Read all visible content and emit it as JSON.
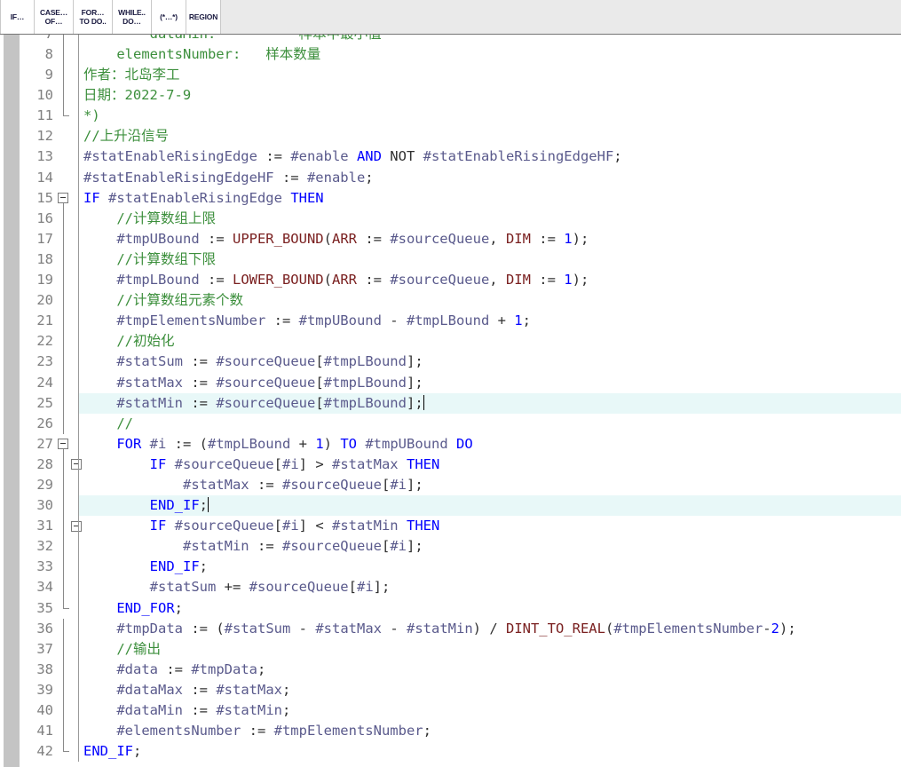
{
  "toolbar": {
    "buttons": [
      {
        "name": "if-button",
        "line1": "IF…",
        "line2": ""
      },
      {
        "name": "case-of-button",
        "line1": "CASE…",
        "line2": "OF…"
      },
      {
        "name": "for-todo-button",
        "line1": "FOR…",
        "line2": "TO DO.."
      },
      {
        "name": "while-do-button",
        "line1": "WHILE..",
        "line2": "DO…"
      },
      {
        "name": "comment-button",
        "line1": "(*…*)",
        "line2": ""
      },
      {
        "name": "region-button",
        "line1": "REGION",
        "line2": ""
      }
    ]
  },
  "editor": {
    "colors": {
      "keyword": "#0000ff",
      "comment": "#3c8f3c",
      "variable": "#5a5a8c",
      "function": "#7a2020",
      "plain": "#303030",
      "line_number": "#808080",
      "highlight_background": "#e8f8f8",
      "left_strip": "#c4c4c4",
      "toolbar_background": "#eaeaea"
    },
    "lines": [
      {
        "number": "7",
        "fold": "line",
        "highlight": false,
        "tokens": [
          {
            "t": "        dataMin:          样本中最小值",
            "c": "cm"
          }
        ]
      },
      {
        "number": "8",
        "fold": "line",
        "highlight": false,
        "tokens": [
          {
            "t": "    elementsNumber:   样本数量",
            "c": "cm"
          }
        ]
      },
      {
        "number": "9",
        "fold": "line",
        "highlight": false,
        "tokens": [
          {
            "t": "作者：北岛李工",
            "c": "cm"
          }
        ]
      },
      {
        "number": "10",
        "fold": "line",
        "highlight": false,
        "tokens": [
          {
            "t": "日期：2022-7-9",
            "c": "cm"
          }
        ]
      },
      {
        "number": "11",
        "fold": "endcap",
        "highlight": false,
        "tokens": [
          {
            "t": "*)",
            "c": "cm"
          }
        ]
      },
      {
        "number": "12",
        "fold": "none",
        "highlight": false,
        "tokens": [
          {
            "t": "//上升沿信号",
            "c": "cm"
          }
        ]
      },
      {
        "number": "13",
        "fold": "none",
        "highlight": false,
        "tokens": [
          {
            "t": "#statEnableRisingEdge ",
            "c": "var"
          },
          {
            "t": ":= ",
            "c": "pl"
          },
          {
            "t": "#enable ",
            "c": "var"
          },
          {
            "t": "AND",
            "c": "kw"
          },
          {
            "t": " NOT ",
            "c": "pl"
          },
          {
            "t": "#statEnableRisingEdgeHF",
            "c": "var"
          },
          {
            "t": ";",
            "c": "pl"
          }
        ]
      },
      {
        "number": "14",
        "fold": "none",
        "highlight": false,
        "tokens": [
          {
            "t": "#statEnableRisingEdgeHF ",
            "c": "var"
          },
          {
            "t": ":= ",
            "c": "pl"
          },
          {
            "t": "#enable",
            "c": "var"
          },
          {
            "t": ";",
            "c": "pl"
          }
        ]
      },
      {
        "number": "15",
        "fold": "box-start",
        "highlight": false,
        "tokens": [
          {
            "t": "IF ",
            "c": "kw"
          },
          {
            "t": "#statEnableRisingEdge ",
            "c": "var"
          },
          {
            "t": "THEN",
            "c": "kw"
          }
        ]
      },
      {
        "number": "16",
        "fold": "line",
        "highlight": false,
        "tokens": [
          {
            "t": "    //计算数组上限",
            "c": "cm"
          }
        ]
      },
      {
        "number": "17",
        "fold": "line",
        "highlight": false,
        "tokens": [
          {
            "t": "    ",
            "c": "pl"
          },
          {
            "t": "#tmpUBound ",
            "c": "var"
          },
          {
            "t": ":= ",
            "c": "pl"
          },
          {
            "t": "UPPER_BOUND",
            "c": "fn"
          },
          {
            "t": "(",
            "c": "pl"
          },
          {
            "t": "ARR",
            "c": "fn"
          },
          {
            "t": " := ",
            "c": "pl"
          },
          {
            "t": "#sourceQueue",
            "c": "var"
          },
          {
            "t": ", ",
            "c": "pl"
          },
          {
            "t": "DIM",
            "c": "fn"
          },
          {
            "t": " := ",
            "c": "pl"
          },
          {
            "t": "1",
            "c": "num"
          },
          {
            "t": ");",
            "c": "pl"
          }
        ]
      },
      {
        "number": "18",
        "fold": "line",
        "highlight": false,
        "tokens": [
          {
            "t": "    //计算数组下限",
            "c": "cm"
          }
        ]
      },
      {
        "number": "19",
        "fold": "line",
        "highlight": false,
        "tokens": [
          {
            "t": "    ",
            "c": "pl"
          },
          {
            "t": "#tmpLBound ",
            "c": "var"
          },
          {
            "t": ":= ",
            "c": "pl"
          },
          {
            "t": "LOWER_BOUND",
            "c": "fn"
          },
          {
            "t": "(",
            "c": "pl"
          },
          {
            "t": "ARR",
            "c": "fn"
          },
          {
            "t": " := ",
            "c": "pl"
          },
          {
            "t": "#sourceQueue",
            "c": "var"
          },
          {
            "t": ", ",
            "c": "pl"
          },
          {
            "t": "DIM",
            "c": "fn"
          },
          {
            "t": " := ",
            "c": "pl"
          },
          {
            "t": "1",
            "c": "num"
          },
          {
            "t": ");",
            "c": "pl"
          }
        ]
      },
      {
        "number": "20",
        "fold": "line",
        "highlight": false,
        "tokens": [
          {
            "t": "    //计算数组元素个数",
            "c": "cm"
          }
        ]
      },
      {
        "number": "21",
        "fold": "line",
        "highlight": false,
        "tokens": [
          {
            "t": "    ",
            "c": "pl"
          },
          {
            "t": "#tmpElementsNumber ",
            "c": "var"
          },
          {
            "t": ":= ",
            "c": "pl"
          },
          {
            "t": "#tmpUBound ",
            "c": "var"
          },
          {
            "t": "- ",
            "c": "pl"
          },
          {
            "t": "#tmpLBound ",
            "c": "var"
          },
          {
            "t": "+ ",
            "c": "pl"
          },
          {
            "t": "1",
            "c": "num"
          },
          {
            "t": ";",
            "c": "pl"
          }
        ]
      },
      {
        "number": "22",
        "fold": "line",
        "highlight": false,
        "tokens": [
          {
            "t": "    //初始化",
            "c": "cm"
          }
        ]
      },
      {
        "number": "23",
        "fold": "line",
        "highlight": false,
        "tokens": [
          {
            "t": "    ",
            "c": "pl"
          },
          {
            "t": "#statSum ",
            "c": "var"
          },
          {
            "t": ":= ",
            "c": "pl"
          },
          {
            "t": "#sourceQueue",
            "c": "var"
          },
          {
            "t": "[",
            "c": "pl"
          },
          {
            "t": "#tmpLBound",
            "c": "var"
          },
          {
            "t": "];",
            "c": "pl"
          }
        ]
      },
      {
        "number": "24",
        "fold": "line",
        "highlight": false,
        "tokens": [
          {
            "t": "    ",
            "c": "pl"
          },
          {
            "t": "#statMax ",
            "c": "var"
          },
          {
            "t": ":= ",
            "c": "pl"
          },
          {
            "t": "#sourceQueue",
            "c": "var"
          },
          {
            "t": "[",
            "c": "pl"
          },
          {
            "t": "#tmpLBound",
            "c": "var"
          },
          {
            "t": "];",
            "c": "pl"
          }
        ]
      },
      {
        "number": "25",
        "fold": "line",
        "highlight": true,
        "caret": true,
        "tokens": [
          {
            "t": "    ",
            "c": "pl"
          },
          {
            "t": "#statMin ",
            "c": "var"
          },
          {
            "t": ":= ",
            "c": "pl"
          },
          {
            "t": "#sourceQueue",
            "c": "var"
          },
          {
            "t": "[",
            "c": "pl"
          },
          {
            "t": "#tmpLBound",
            "c": "var"
          },
          {
            "t": "];",
            "c": "pl"
          }
        ]
      },
      {
        "number": "26",
        "fold": "line",
        "highlight": false,
        "tokens": [
          {
            "t": "    //",
            "c": "cm"
          }
        ]
      },
      {
        "number": "27",
        "fold": "box-start",
        "highlight": false,
        "tokens": [
          {
            "t": "    ",
            "c": "pl"
          },
          {
            "t": "FOR ",
            "c": "kw"
          },
          {
            "t": "#i ",
            "c": "var"
          },
          {
            "t": ":= (",
            "c": "pl"
          },
          {
            "t": "#tmpLBound ",
            "c": "var"
          },
          {
            "t": "+ ",
            "c": "pl"
          },
          {
            "t": "1",
            "c": "num"
          },
          {
            "t": ") ",
            "c": "pl"
          },
          {
            "t": "TO ",
            "c": "kw"
          },
          {
            "t": "#tmpUBound ",
            "c": "var"
          },
          {
            "t": "DO",
            "c": "kw"
          }
        ]
      },
      {
        "number": "28",
        "fold": "box-start2",
        "highlight": false,
        "tokens": [
          {
            "t": "        ",
            "c": "pl"
          },
          {
            "t": "IF ",
            "c": "kw"
          },
          {
            "t": "#sourceQueue",
            "c": "var"
          },
          {
            "t": "[",
            "c": "pl"
          },
          {
            "t": "#i",
            "c": "var"
          },
          {
            "t": "] > ",
            "c": "pl"
          },
          {
            "t": "#statMax ",
            "c": "var"
          },
          {
            "t": "THEN",
            "c": "kw"
          }
        ]
      },
      {
        "number": "29",
        "fold": "line2",
        "highlight": false,
        "tokens": [
          {
            "t": "            ",
            "c": "pl"
          },
          {
            "t": "#statMax ",
            "c": "var"
          },
          {
            "t": ":= ",
            "c": "pl"
          },
          {
            "t": "#sourceQueue",
            "c": "var"
          },
          {
            "t": "[",
            "c": "pl"
          },
          {
            "t": "#i",
            "c": "var"
          },
          {
            "t": "];",
            "c": "pl"
          }
        ]
      },
      {
        "number": "30",
        "fold": "endcap2",
        "highlight": true,
        "caret": true,
        "tokens": [
          {
            "t": "        ",
            "c": "pl"
          },
          {
            "t": "END_IF",
            "c": "kw"
          },
          {
            "t": ";",
            "c": "pl"
          }
        ]
      },
      {
        "number": "31",
        "fold": "box-start2",
        "highlight": false,
        "tokens": [
          {
            "t": "        ",
            "c": "pl"
          },
          {
            "t": "IF ",
            "c": "kw"
          },
          {
            "t": "#sourceQueue",
            "c": "var"
          },
          {
            "t": "[",
            "c": "pl"
          },
          {
            "t": "#i",
            "c": "var"
          },
          {
            "t": "] < ",
            "c": "pl"
          },
          {
            "t": "#statMin ",
            "c": "var"
          },
          {
            "t": "THEN",
            "c": "kw"
          }
        ]
      },
      {
        "number": "32",
        "fold": "line2",
        "highlight": false,
        "tokens": [
          {
            "t": "            ",
            "c": "pl"
          },
          {
            "t": "#statMin ",
            "c": "var"
          },
          {
            "t": ":= ",
            "c": "pl"
          },
          {
            "t": "#sourceQueue",
            "c": "var"
          },
          {
            "t": "[",
            "c": "pl"
          },
          {
            "t": "#i",
            "c": "var"
          },
          {
            "t": "];",
            "c": "pl"
          }
        ]
      },
      {
        "number": "33",
        "fold": "endcap2",
        "highlight": false,
        "tokens": [
          {
            "t": "        ",
            "c": "pl"
          },
          {
            "t": "END_IF",
            "c": "kw"
          },
          {
            "t": ";",
            "c": "pl"
          }
        ]
      },
      {
        "number": "34",
        "fold": "line",
        "highlight": false,
        "tokens": [
          {
            "t": "        ",
            "c": "pl"
          },
          {
            "t": "#statSum ",
            "c": "var"
          },
          {
            "t": "+= ",
            "c": "pl"
          },
          {
            "t": "#sourceQueue",
            "c": "var"
          },
          {
            "t": "[",
            "c": "pl"
          },
          {
            "t": "#i",
            "c": "var"
          },
          {
            "t": "];",
            "c": "pl"
          }
        ]
      },
      {
        "number": "35",
        "fold": "endcap",
        "highlight": false,
        "tokens": [
          {
            "t": "    ",
            "c": "pl"
          },
          {
            "t": "END_FOR",
            "c": "kw"
          },
          {
            "t": ";",
            "c": "pl"
          }
        ]
      },
      {
        "number": "36",
        "fold": "line",
        "highlight": false,
        "tokens": [
          {
            "t": "    ",
            "c": "pl"
          },
          {
            "t": "#tmpData ",
            "c": "var"
          },
          {
            "t": ":= (",
            "c": "pl"
          },
          {
            "t": "#statSum ",
            "c": "var"
          },
          {
            "t": "- ",
            "c": "pl"
          },
          {
            "t": "#statMax ",
            "c": "var"
          },
          {
            "t": "- ",
            "c": "pl"
          },
          {
            "t": "#statMin",
            "c": "var"
          },
          {
            "t": ") / ",
            "c": "pl"
          },
          {
            "t": "DINT_TO_REAL",
            "c": "fn"
          },
          {
            "t": "(",
            "c": "pl"
          },
          {
            "t": "#tmpElementsNumber",
            "c": "var"
          },
          {
            "t": "-",
            "c": "pl"
          },
          {
            "t": "2",
            "c": "num"
          },
          {
            "t": ");",
            "c": "pl"
          }
        ]
      },
      {
        "number": "37",
        "fold": "line",
        "highlight": false,
        "tokens": [
          {
            "t": "    //输出",
            "c": "cm"
          }
        ]
      },
      {
        "number": "38",
        "fold": "line",
        "highlight": false,
        "tokens": [
          {
            "t": "    ",
            "c": "pl"
          },
          {
            "t": "#data ",
            "c": "var"
          },
          {
            "t": ":= ",
            "c": "pl"
          },
          {
            "t": "#tmpData",
            "c": "var"
          },
          {
            "t": ";",
            "c": "pl"
          }
        ]
      },
      {
        "number": "39",
        "fold": "line",
        "highlight": false,
        "tokens": [
          {
            "t": "    ",
            "c": "pl"
          },
          {
            "t": "#dataMax ",
            "c": "var"
          },
          {
            "t": ":= ",
            "c": "pl"
          },
          {
            "t": "#statMax",
            "c": "var"
          },
          {
            "t": ";",
            "c": "pl"
          }
        ]
      },
      {
        "number": "40",
        "fold": "line",
        "highlight": false,
        "tokens": [
          {
            "t": "    ",
            "c": "pl"
          },
          {
            "t": "#dataMin ",
            "c": "var"
          },
          {
            "t": ":= ",
            "c": "pl"
          },
          {
            "t": "#statMin",
            "c": "var"
          },
          {
            "t": ";",
            "c": "pl"
          }
        ]
      },
      {
        "number": "41",
        "fold": "line",
        "highlight": false,
        "tokens": [
          {
            "t": "    ",
            "c": "pl"
          },
          {
            "t": "#elementsNumber ",
            "c": "var"
          },
          {
            "t": ":= ",
            "c": "pl"
          },
          {
            "t": "#tmpElementsNumber",
            "c": "var"
          },
          {
            "t": ";",
            "c": "pl"
          }
        ]
      },
      {
        "number": "42",
        "fold": "endcap",
        "highlight": false,
        "tokens": [
          {
            "t": "END_IF",
            "c": "kw"
          },
          {
            "t": ";",
            "c": "pl"
          }
        ]
      }
    ]
  }
}
